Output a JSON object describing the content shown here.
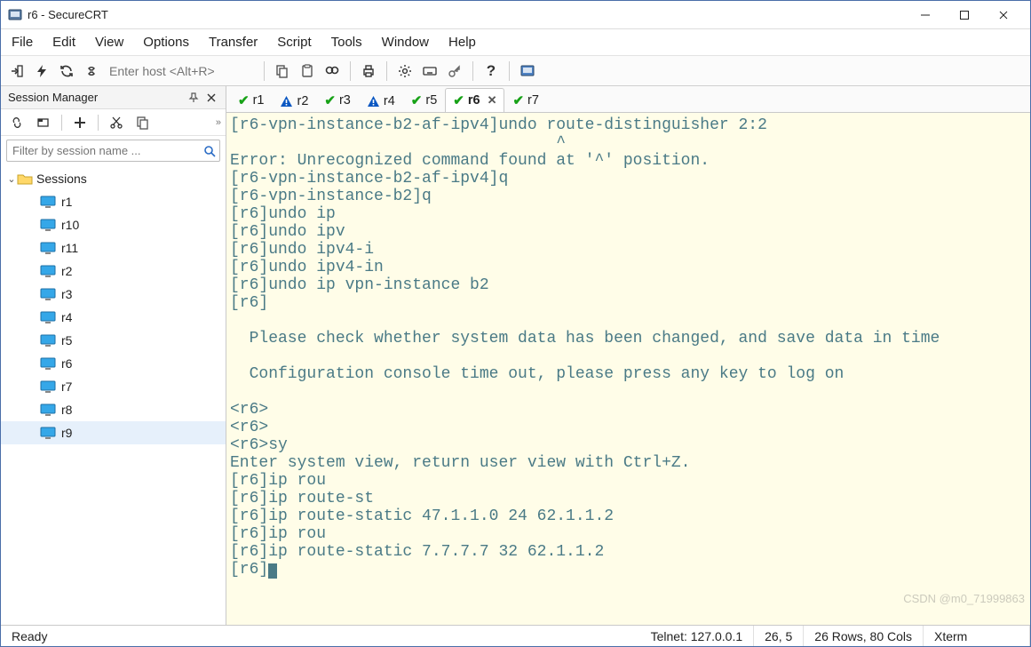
{
  "window": {
    "title": "r6 - SecureCRT"
  },
  "menu": {
    "items": [
      "File",
      "Edit",
      "View",
      "Options",
      "Transfer",
      "Script",
      "Tools",
      "Window",
      "Help"
    ]
  },
  "toolbar": {
    "host_placeholder": "Enter host <Alt+R>"
  },
  "session_manager": {
    "title": "Session Manager",
    "filter_placeholder": "Filter by session name ...",
    "root": "Sessions",
    "items": [
      "r1",
      "r10",
      "r11",
      "r2",
      "r3",
      "r4",
      "r5",
      "r6",
      "r7",
      "r8",
      "r9"
    ],
    "selected": "r9"
  },
  "tabs": {
    "items": [
      {
        "label": "r1",
        "status": "ok"
      },
      {
        "label": "r2",
        "status": "warn"
      },
      {
        "label": "r3",
        "status": "ok"
      },
      {
        "label": "r4",
        "status": "warn"
      },
      {
        "label": "r5",
        "status": "ok"
      },
      {
        "label": "r6",
        "status": "ok",
        "active": true,
        "closable": true
      },
      {
        "label": "r7",
        "status": "ok"
      }
    ]
  },
  "terminal": {
    "lines": [
      "[r6-vpn-instance-b2-af-ipv4]undo route-distinguisher 2:2",
      "                                  ^",
      "Error: Unrecognized command found at '^' position.",
      "[r6-vpn-instance-b2-af-ipv4]q",
      "[r6-vpn-instance-b2]q",
      "[r6]undo ip",
      "[r6]undo ipv",
      "[r6]undo ipv4-i",
      "[r6]undo ipv4-in",
      "[r6]undo ip vpn-instance b2",
      "[r6]",
      "",
      "  Please check whether system data has been changed, and save data in time",
      "",
      "  Configuration console time out, please press any key to log on",
      "",
      "<r6>",
      "<r6>",
      "<r6>sy",
      "Enter system view, return user view with Ctrl+Z.",
      "[r6]ip rou",
      "[r6]ip route-st",
      "[r6]ip route-static 47.1.1.0 24 62.1.1.2",
      "[r6]ip rou",
      "[r6]ip route-static 7.7.7.7 32 62.1.1.2",
      "[r6]"
    ]
  },
  "status": {
    "ready": "Ready",
    "conn": "Telnet: 127.0.0.1",
    "pos": "26,   5",
    "size": "26 Rows, 80 Cols",
    "emu": "Xterm"
  },
  "watermark": "CSDN @m0_71999863"
}
